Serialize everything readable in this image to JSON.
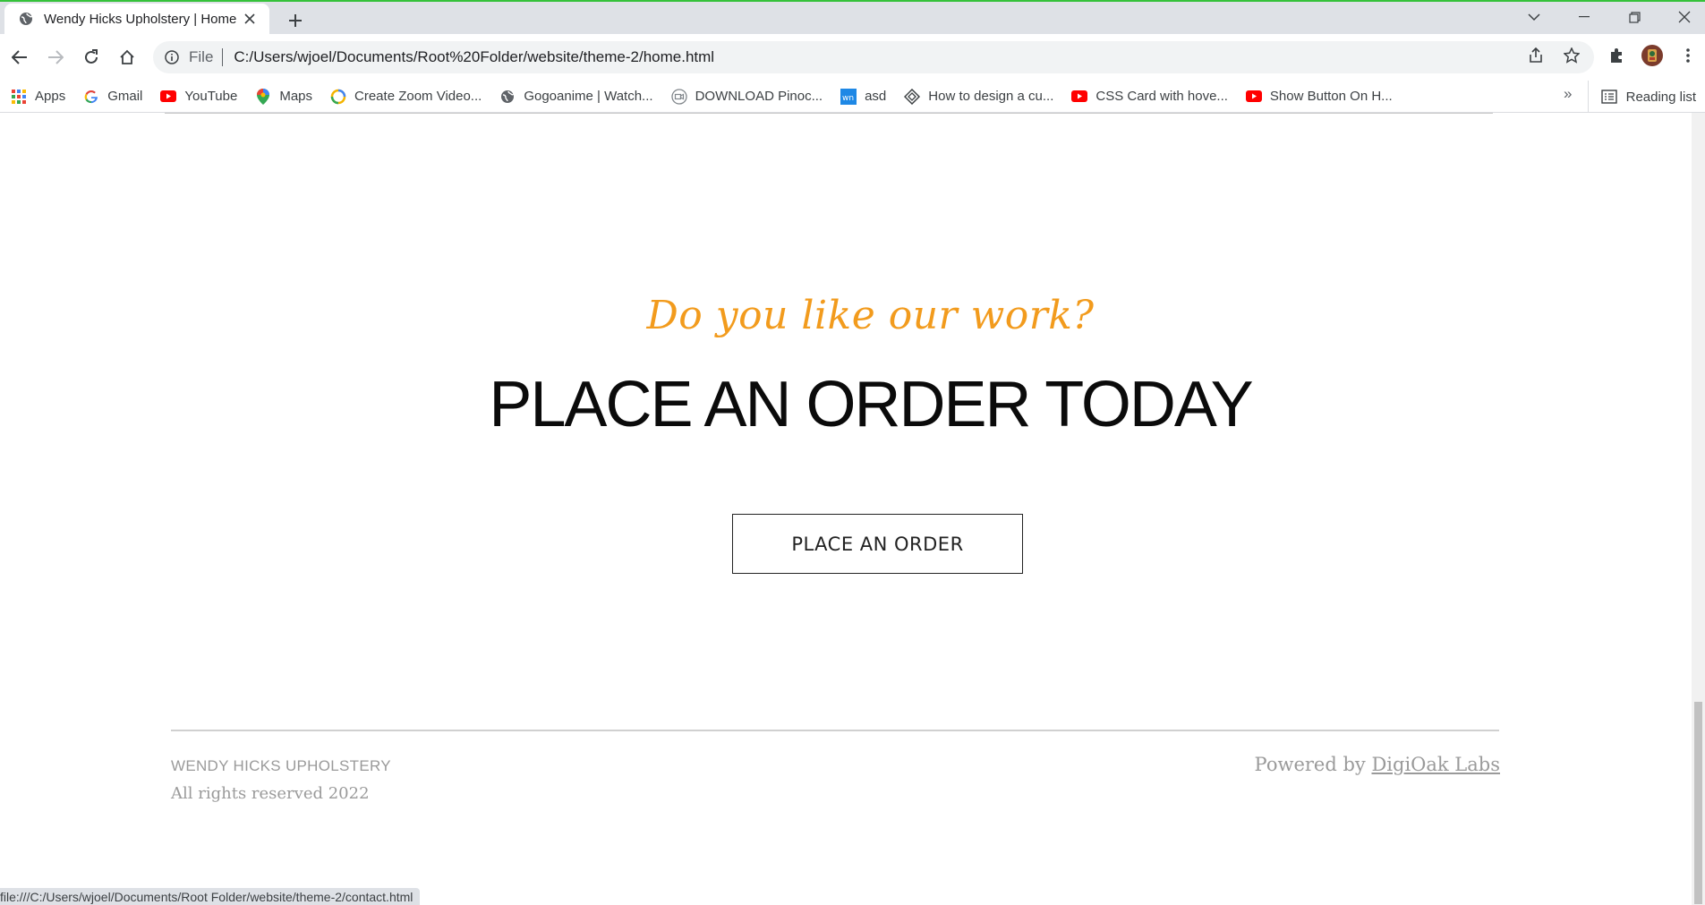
{
  "browser": {
    "tab_title": "Wendy Hicks Upholstery | Home",
    "scheme_label": "File",
    "url": "C:/Users/wjoel/Documents/Root%20Folder/website/theme-2/home.html",
    "status_url": "file:///C:/Users/wjoel/Documents/Root Folder/website/theme-2/contact.html",
    "accent_color": "#35c23a"
  },
  "bookmarks": {
    "items": [
      {
        "label": "Apps",
        "icon": "apps-grid-icon"
      },
      {
        "label": "Gmail",
        "icon": "google-icon"
      },
      {
        "label": "YouTube",
        "icon": "youtube-icon"
      },
      {
        "label": "Maps",
        "icon": "maps-pin-icon"
      },
      {
        "label": "Create Zoom Video...",
        "icon": "swirl-icon"
      },
      {
        "label": "Gogoanime | Watch...",
        "icon": "globe-icon"
      },
      {
        "label": "DOWNLOAD Pinoc...",
        "icon": "video-camera-icon"
      },
      {
        "label": "asd",
        "icon": "wn-icon"
      },
      {
        "label": "How to design a cu...",
        "icon": "diamond-icon"
      },
      {
        "label": "CSS Card with hove...",
        "icon": "youtube-icon"
      },
      {
        "label": "Show Button On H...",
        "icon": "youtube-icon"
      }
    ],
    "more_label": "»",
    "reading_list_label": "Reading list"
  },
  "page": {
    "tagline": "Do you like our work?",
    "headline": "PLACE AN ORDER TODAY",
    "order_button_label": "PLACE AN ORDER",
    "tagline_color": "#f29b1d",
    "footer": {
      "brand": "WENDY HICKS UPHOLSTERY",
      "rights": "All rights reserved 2022",
      "powered_prefix": "Powered by",
      "powered_link": "DigiOak Labs"
    }
  }
}
